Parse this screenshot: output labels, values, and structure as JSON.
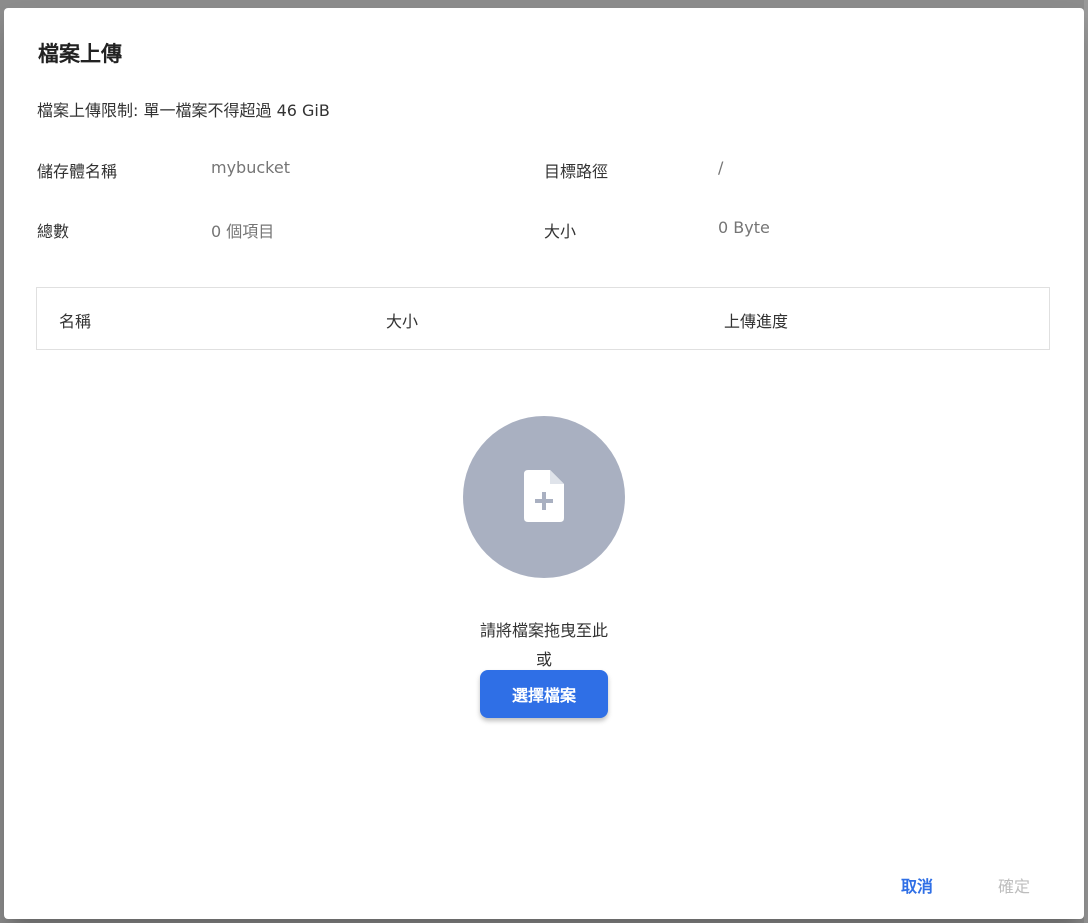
{
  "dialog": {
    "title": "檔案上傳",
    "upload_limit": "檔案上傳限制: 單一檔案不得超過 46 GiB"
  },
  "info": {
    "bucket_label": "儲存體名稱",
    "bucket_value": "mybucket",
    "target_path_label": "目標路徑",
    "target_path_value": "/",
    "total_label": "總數",
    "total_value": "0 個項目",
    "size_label": "大小",
    "size_value": "0 Byte"
  },
  "table": {
    "columns": [
      "名稱",
      "大小",
      "上傳進度"
    ]
  },
  "dropzone": {
    "icon": "file-plus-icon",
    "hint": "請將檔案拖曳至此",
    "or": "或",
    "select_button": "選擇檔案"
  },
  "footer": {
    "cancel": "取消",
    "confirm": "確定"
  },
  "colors": {
    "primary": "#2f6fe6",
    "dropzone_circle": "#a9b0c1",
    "disabled_text": "#bdbdbd"
  }
}
